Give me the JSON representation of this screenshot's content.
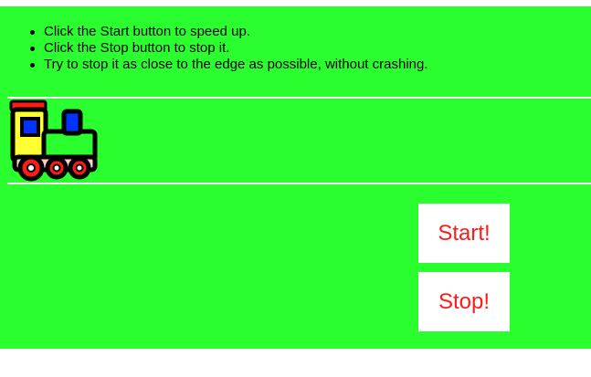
{
  "instructions": [
    "Click the Start button to speed up.",
    "Click the Stop button to stop it.",
    "Try to stop it as close to the edge as possible, without crashing."
  ],
  "controls": {
    "start_label": "Start!",
    "stop_label": "Stop!"
  },
  "icons": {
    "train": "train-icon"
  },
  "colors": {
    "background": "#2bfe2f",
    "track": "#ffffff",
    "button_bg": "#ffffff",
    "button_text": "#ff1a1a"
  }
}
